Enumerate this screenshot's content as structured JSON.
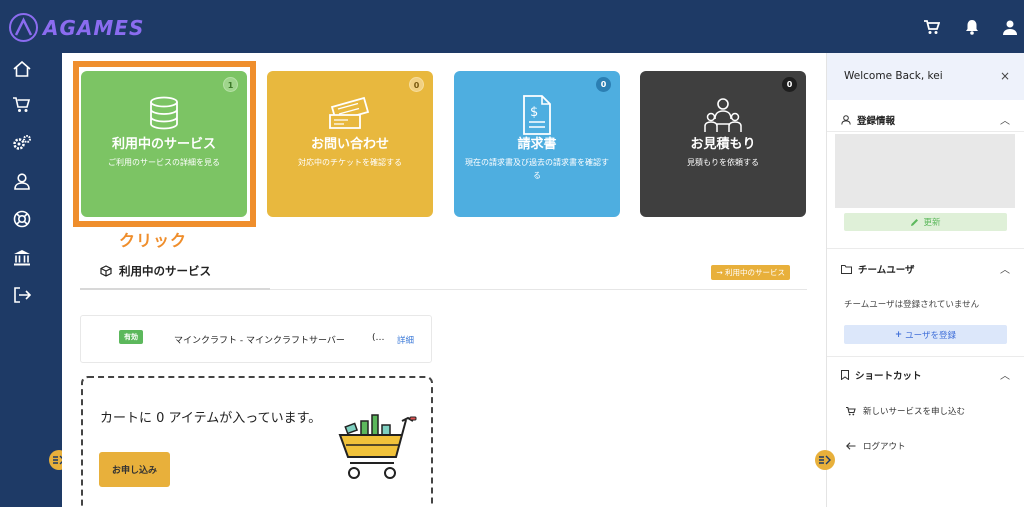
{
  "app": {
    "logo_text": "AGAMES"
  },
  "header": {
    "icons": [
      "cart-icon",
      "bell-icon",
      "user-icon"
    ]
  },
  "sidebar": {
    "items": [
      "home-icon",
      "cart-icon",
      "gears-icon",
      "user-icon",
      "support-icon",
      "bank-icon",
      "logout-icon"
    ]
  },
  "cards": [
    {
      "title": "利用中のサービス",
      "subtitle": "ご利用のサービスの詳細を見る",
      "badge": "1",
      "color": "#7cc464",
      "icon": "database-icon"
    },
    {
      "title": "お問い合わせ",
      "subtitle": "対応中のチケットを確認する",
      "badge": "0",
      "color": "#e8b83e",
      "icon": "ticket-icon"
    },
    {
      "title": "請求書",
      "subtitle": "現在の請求書及び過去の請求書を確認する",
      "badge": "0",
      "color": "#4eaee0",
      "icon": "invoice-icon"
    },
    {
      "title": "お見積もり",
      "subtitle": "見積もりを依頼する",
      "badge": "0",
      "color": "#3f3f3f",
      "icon": "team-icon"
    }
  ],
  "annotation": {
    "click_label": "クリック",
    "color": "#ef8e2c"
  },
  "services": {
    "title": "利用中のサービス",
    "link_label": "→ 利用中のサービス",
    "rows": [
      {
        "status": "有効",
        "name": "マインクラフト - マインクラフトサーバー",
        "more": "(…",
        "detail": "詳細"
      }
    ]
  },
  "cart": {
    "message": "カートに 0 アイテムが入っています。",
    "button": "お申し込み"
  },
  "right_panel": {
    "welcome": "Welcome Back, kei",
    "close": "×",
    "registration": {
      "title": "登録情報",
      "update_button": "更新"
    },
    "team": {
      "title": "チームユーザ",
      "empty_text": "チームユーザは登録されていません",
      "add_button": "ユーザを登録"
    },
    "shortcuts": {
      "title": "ショートカット",
      "items": [
        "新しいサービスを申し込む",
        "ログアウト"
      ]
    }
  }
}
